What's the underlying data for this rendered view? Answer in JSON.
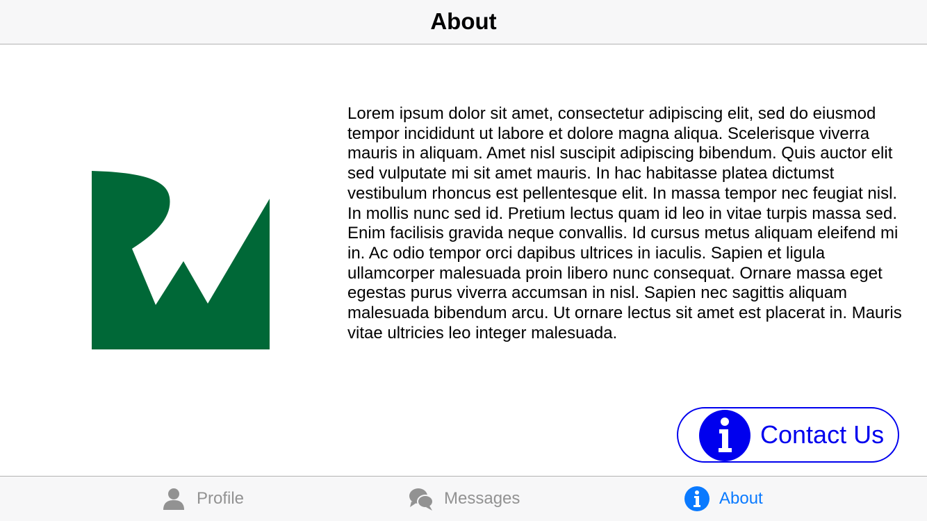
{
  "navbar": {
    "title": "About"
  },
  "logo": {
    "icon": "rw-logo",
    "color": "#006837"
  },
  "about": {
    "body": "Lorem ipsum dolor sit amet, consectetur adipiscing elit, sed do eiusmod tempor incididunt ut labore et dolore magna aliqua. Scelerisque viverra mauris in aliquam. Amet nisl suscipit adipiscing bibendum. Quis auctor elit sed vulputate mi sit amet mauris. In hac habitasse platea dictumst vestibulum rhoncus est pellentesque elit. In massa tempor nec feugiat nisl. In mollis nunc sed id. Pretium lectus quam id leo in vitae turpis massa sed. Enim facilisis gravida neque convallis. Id cursus metus aliquam eleifend mi in. Ac odio tempor orci dapibus ultrices in iaculis. Sapien et ligula ullamcorper malesuada proin libero nunc consequat. Ornare massa eget egestas purus viverra accumsan in nisl. Sapien nec sagittis aliquam malesuada bibendum arcu. Ut ornare lectus sit amet est placerat in. Mauris vitae ultricies leo integer malesuada."
  },
  "contact": {
    "label": "Contact Us",
    "icon": "info-icon",
    "color": "#0000ee"
  },
  "tabs": [
    {
      "label": "Profile",
      "icon": "person-icon",
      "active": false
    },
    {
      "label": "Messages",
      "icon": "chat-bubbles-icon",
      "active": false
    },
    {
      "label": "About",
      "icon": "info-icon",
      "active": true
    }
  ],
  "colors": {
    "tab_active": "#0a7aff",
    "tab_inactive": "#929292",
    "bar_background": "#f7f7f8"
  }
}
